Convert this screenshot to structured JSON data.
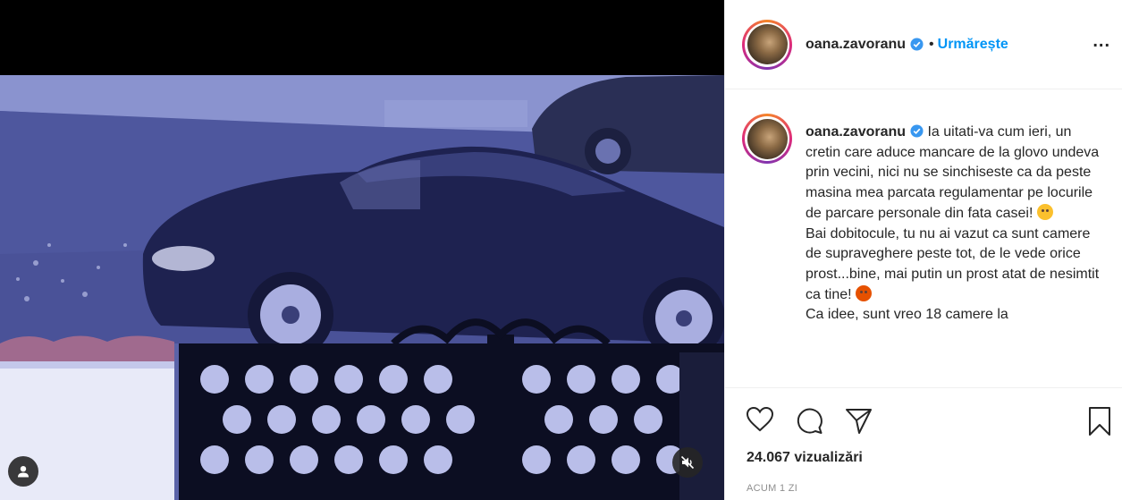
{
  "post": {
    "username": "oana.zavoranu",
    "verified": true,
    "follow_label": "Urmărește",
    "header_separator": "•",
    "more_label": "...",
    "caption_text": "Ia uitati-va cum ieri, un cretin care aduce mancare de la glovo undeva prin vecini, nici nu se sinchiseste ca da peste masina mea parcata regulamentar pe locurile de parcare personale din fata casei!",
    "caption_text_2": "Bai dobitocule, tu nu ai vazut ca sunt camere de supraveghere peste tot, de le vede orice prost...bine, mai putin un prost atat de nesimtit ca tine!",
    "caption_text_3": "Ca idee, sunt vreo 18 camere la",
    "views": "24.067 vizualizări",
    "timestamp": "ACUM 1 ZI"
  },
  "icons": {
    "verified": "verified-badge-icon",
    "like": "heart-icon",
    "comment": "comment-bubble-icon",
    "share": "paper-plane-icon",
    "save": "bookmark-icon",
    "tag": "user-tag-icon",
    "mute": "speaker-muted-icon",
    "emoji_1": "confused-face-emoji",
    "emoji_2": "face-with-symbols-emoji"
  },
  "colors": {
    "accent": "#0095f6",
    "text": "#262626",
    "secondary": "#8e8e8e",
    "verified": "#3897f0"
  }
}
